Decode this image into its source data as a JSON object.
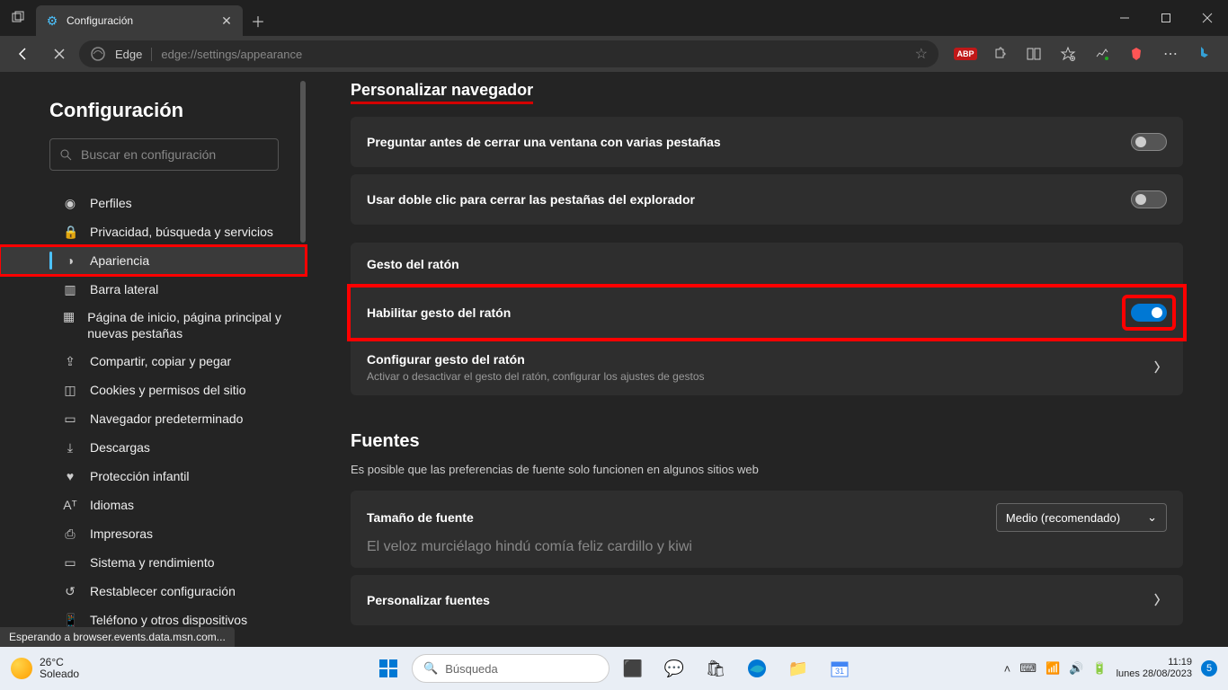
{
  "tab": {
    "title": "Configuración"
  },
  "url": {
    "label": "Edge",
    "path": "edge://settings/appearance"
  },
  "toolbar_ext": {
    "abp": "ABP"
  },
  "sidebar": {
    "title": "Configuración",
    "search_placeholder": "Buscar en configuración",
    "items": [
      {
        "label": "Perfiles"
      },
      {
        "label": "Privacidad, búsqueda y servicios"
      },
      {
        "label": "Apariencia"
      },
      {
        "label": "Barra lateral"
      },
      {
        "label": "Página de inicio, página principal y nuevas pestañas"
      },
      {
        "label": "Compartir, copiar y pegar"
      },
      {
        "label": "Cookies y permisos del sitio"
      },
      {
        "label": "Navegador predeterminado"
      },
      {
        "label": "Descargas"
      },
      {
        "label": "Protección infantil"
      },
      {
        "label": "Idiomas"
      },
      {
        "label": "Impresoras"
      },
      {
        "label": "Sistema y rendimiento"
      },
      {
        "label": "Restablecer configuración"
      },
      {
        "label": "Teléfono y otros dispositivos"
      }
    ]
  },
  "content": {
    "section1_title": "Personalizar navegador",
    "row_ask_close": "Preguntar antes de cerrar una ventana con varias pestañas",
    "row_dblclick": "Usar doble clic para cerrar las pestañas del explorador",
    "group_mouse": "Gesto del ratón",
    "row_enable_gesture": "Habilitar gesto del ratón",
    "row_config_gesture": "Configurar gesto del ratón",
    "row_config_gesture_desc": "Activar o desactivar el gesto del ratón, configurar los ajustes de gestos",
    "section2_title": "Fuentes",
    "section2_sub": "Es posible que las preferencias de fuente solo funcionen en algunos sitios web",
    "font_size_label": "Tamaño de fuente",
    "font_size_value": "Medio (recomendado)",
    "font_sample": "El veloz murciélago hindú comía feliz cardillo y kiwi",
    "custom_fonts": "Personalizar fuentes"
  },
  "status": "Esperando a browser.events.data.msn.com...",
  "taskbar": {
    "temp": "26°C",
    "weather": "Soleado",
    "search_placeholder": "Búsqueda",
    "time": "11:19",
    "date": "lunes 28/08/2023",
    "notif_count": "5"
  }
}
